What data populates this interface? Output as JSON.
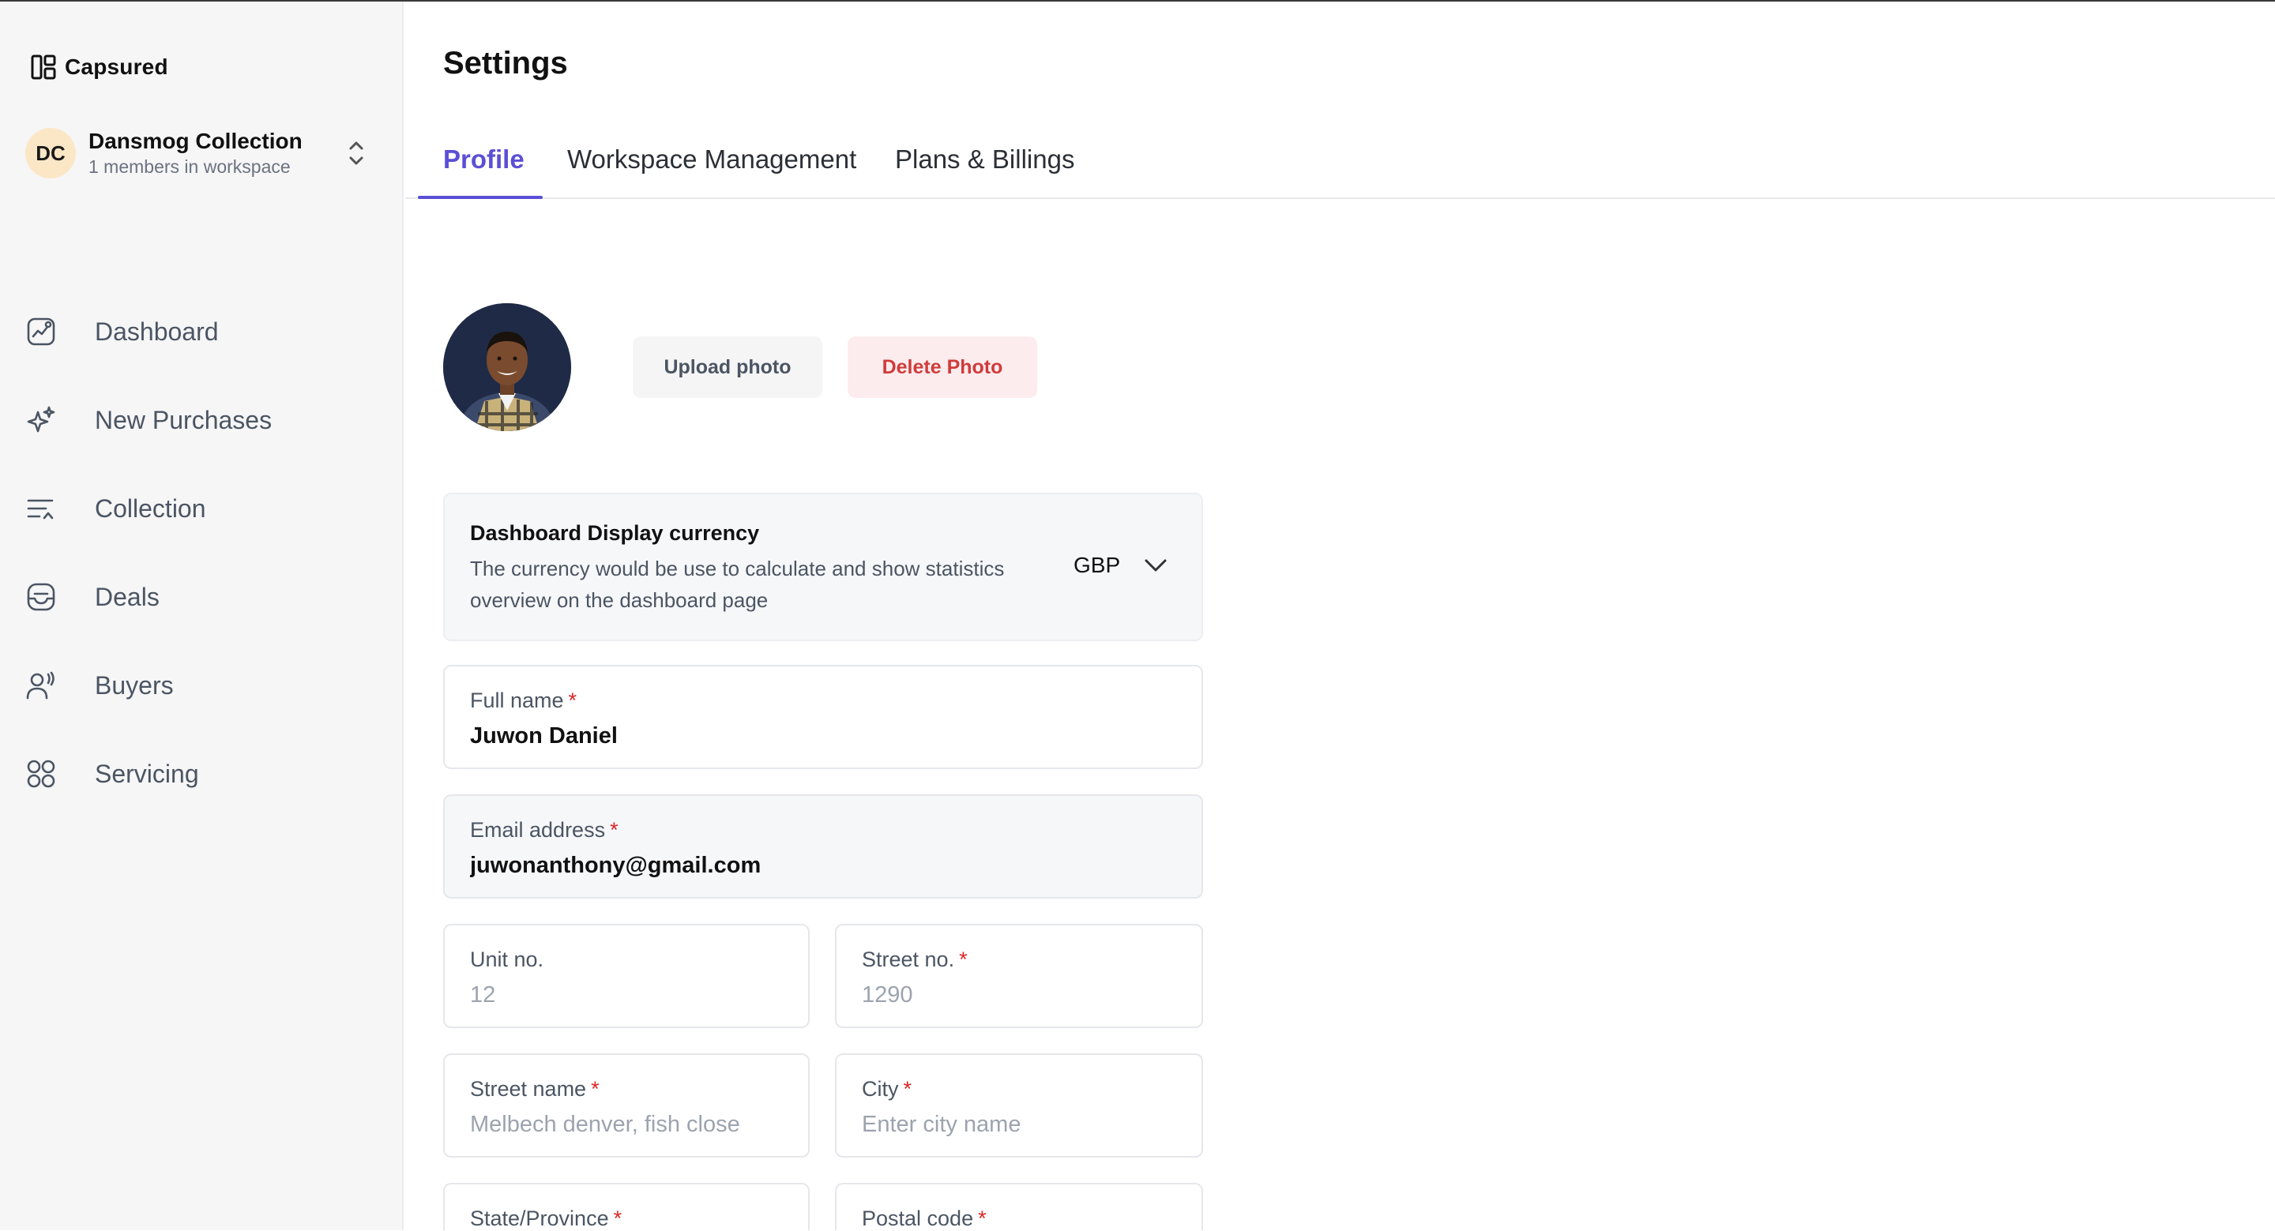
{
  "brand": {
    "name": "Capsured"
  },
  "workspace": {
    "initials": "DC",
    "name": "Dansmog Collection",
    "subtitle": "1 members in workspace"
  },
  "nav": [
    {
      "label": "Dashboard",
      "icon": "chart-icon"
    },
    {
      "label": "New Purchases",
      "icon": "sparkle-icon"
    },
    {
      "label": "Collection",
      "icon": "list-icon"
    },
    {
      "label": "Deals",
      "icon": "deals-icon"
    },
    {
      "label": "Buyers",
      "icon": "user-icon"
    },
    {
      "label": "Servicing",
      "icon": "grid-icon"
    }
  ],
  "page": {
    "title": "Settings"
  },
  "tabs": [
    {
      "label": "Profile",
      "active": true
    },
    {
      "label": "Workspace Management",
      "active": false
    },
    {
      "label": "Plans & Billings",
      "active": false
    }
  ],
  "photo": {
    "upload_label": "Upload photo",
    "delete_label": "Delete Photo"
  },
  "currency": {
    "title": "Dashboard Display currency",
    "description": "The currency would be use to calculate and show statistics overview on the dashboard page",
    "value": "GBP"
  },
  "form": {
    "full_name": {
      "label": "Full name",
      "required": "*",
      "value": "Juwon Daniel"
    },
    "email": {
      "label": "Email address",
      "required": "*",
      "value": "juwonanthony@gmail.com"
    },
    "unit_no": {
      "label": "Unit no.",
      "placeholder": "12"
    },
    "street_no": {
      "label": "Street no.",
      "required": "*",
      "placeholder": "1290"
    },
    "street_name": {
      "label": "Street name",
      "required": "*",
      "placeholder": "Melbech denver, fish close"
    },
    "city": {
      "label": "City",
      "required": "*",
      "placeholder": "Enter city name"
    },
    "state": {
      "label": "State/Province",
      "required": "*"
    },
    "postal": {
      "label": "Postal code",
      "required": "*"
    }
  },
  "colors": {
    "accent": "#5b4fd6",
    "danger": "#d03b3b",
    "required": "#dc2626",
    "sidebar_bg": "#f6f6f7"
  }
}
